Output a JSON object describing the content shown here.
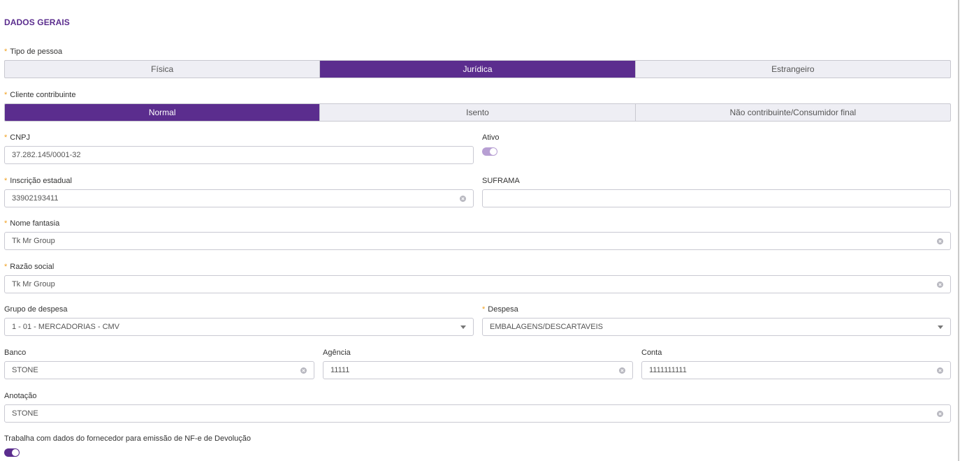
{
  "section": {
    "title": "DADOS GERAIS"
  },
  "tipo_pessoa": {
    "label": "Tipo de pessoa",
    "options": [
      "Física",
      "Jurídica",
      "Estrangeiro"
    ],
    "selected": "Jurídica"
  },
  "cliente_contribuinte": {
    "label": "Cliente contribuinte",
    "options": [
      "Normal",
      "Isento",
      "Não contribuinte/Consumidor final"
    ],
    "selected": "Normal"
  },
  "cnpj": {
    "label": "CNPJ",
    "value": "37.282.145/0001-32"
  },
  "ativo": {
    "label": "Ativo",
    "on": true
  },
  "inscricao_estadual": {
    "label": "Inscrição estadual",
    "value": "33902193411"
  },
  "suframa": {
    "label": "SUFRAMA",
    "value": ""
  },
  "nome_fantasia": {
    "label": "Nome fantasia",
    "value": "Tk Mr Group"
  },
  "razao_social": {
    "label": "Razão social",
    "value": "Tk Mr Group"
  },
  "grupo_despesa": {
    "label": "Grupo de despesa",
    "value": "1 - 01 - MERCADORIAS - CMV"
  },
  "despesa": {
    "label": "Despesa",
    "value": "EMBALAGENS/DESCARTAVEIS"
  },
  "banco": {
    "label": "Banco",
    "value": "STONE"
  },
  "agencia": {
    "label": "Agência",
    "value": "11111"
  },
  "conta": {
    "label": "Conta",
    "value": "1111111111"
  },
  "anotacao": {
    "label": "Anotação",
    "value": "STONE"
  },
  "devolucao": {
    "label": "Trabalha com dados do fornecedor para emissão de NF-e de Devolução",
    "on": true
  },
  "colors": {
    "accent": "#5b2d8e",
    "required": "#f0a020"
  },
  "icons": {
    "clear": "clear-icon",
    "dropdown": "chevron-down-icon"
  }
}
